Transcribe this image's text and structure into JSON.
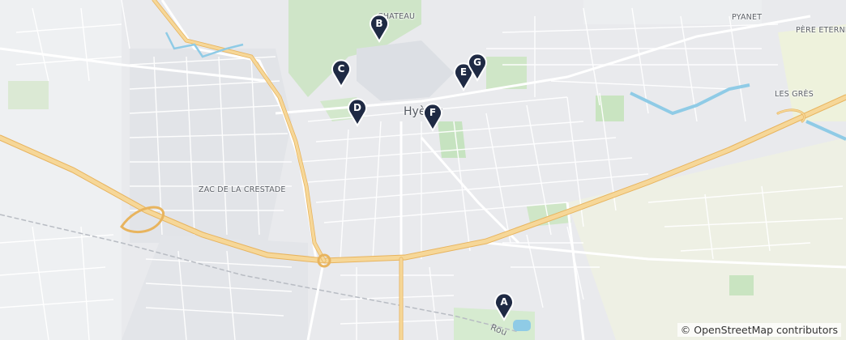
{
  "map": {
    "place_labels": [
      "CHATEAU",
      "PYANET",
      "PÈRE ETERNEL",
      "LES GRÈS",
      "ZAC DE LA CRESTADE"
    ],
    "city_label": "Hyères",
    "road_label": "Rou",
    "colors": {
      "background": "#e9eaed",
      "motorway": "#f2c97a",
      "water": "#8fcbe6",
      "park": "#c6e3c0",
      "marker": "#1f2a44"
    }
  },
  "markers": [
    {
      "letter": "A",
      "icon": "map-pin-icon"
    },
    {
      "letter": "B",
      "icon": "map-pin-icon"
    },
    {
      "letter": "C",
      "icon": "map-pin-icon"
    },
    {
      "letter": "D",
      "icon": "map-pin-icon"
    },
    {
      "letter": "E",
      "icon": "map-pin-icon"
    },
    {
      "letter": "F",
      "icon": "map-pin-icon"
    },
    {
      "letter": "G",
      "icon": "map-pin-icon"
    }
  ],
  "attribution": {
    "symbol": "©",
    "text": "OpenStreetMap contributors"
  }
}
